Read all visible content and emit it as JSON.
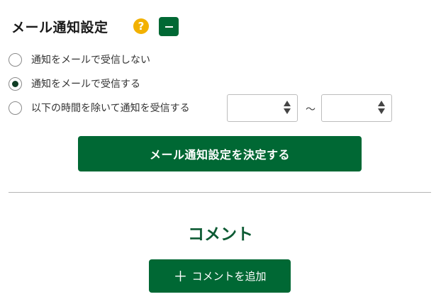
{
  "header": {
    "title": "メール通知設定",
    "help_icon": "?",
    "collapse_icon": "minus-icon"
  },
  "notification_options": [
    {
      "label": "通知をメールで受信しない",
      "checked": false
    },
    {
      "label": "通知をメールで受信する",
      "checked": true
    },
    {
      "label": "以下の時間を除いて通知を受信する",
      "checked": false
    }
  ],
  "time_range": {
    "from_value": "",
    "to_value": "",
    "separator": "～"
  },
  "submit_button": {
    "label": "メール通知設定を決定する"
  },
  "comments": {
    "heading": "コメント",
    "add_button_icon": "＋",
    "add_button_label": "コメントを追加"
  },
  "colors": {
    "primary_green": "#006834",
    "heading_green": "#0c5a33",
    "help_yellow": "#f2b100"
  }
}
